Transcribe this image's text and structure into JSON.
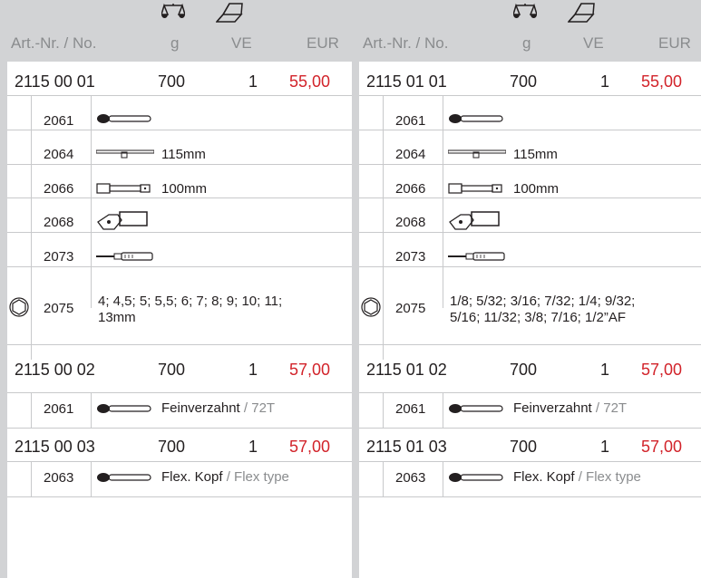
{
  "header": {
    "col1": "Art.-Nr. / No.",
    "col2": "g",
    "col3": "VE",
    "col4": "EUR",
    "icons": [
      "weight-scale-icon",
      "box-icon"
    ]
  },
  "left": {
    "products": [
      {
        "art": "2115 00 01",
        "g": "700",
        "ve": "1",
        "eur": "55,00"
      },
      {
        "art": "2115 00 02",
        "g": "700",
        "ve": "1",
        "eur": "57,00"
      },
      {
        "art": "2115 00 03",
        "g": "700",
        "ve": "1",
        "eur": "57,00"
      }
    ],
    "items": [
      {
        "no": "2061",
        "text": ""
      },
      {
        "no": "2064",
        "text": "115mm"
      },
      {
        "no": "2066",
        "text": "100mm"
      },
      {
        "no": "2068",
        "text": ""
      },
      {
        "no": "2073",
        "text": ""
      },
      {
        "no": "2075",
        "text_l1": "4; 4,5; 5; 5,5; 6; 7; 8; 9; 10; 11;",
        "text_l2": "13mm"
      }
    ],
    "item_2": {
      "no": "2061",
      "text": "Feinverzahnt",
      "text_gray": "/ 72T"
    },
    "item_3": {
      "no": "2063",
      "text": "Flex. Kopf",
      "text_gray": "/ Flex type"
    }
  },
  "right": {
    "products": [
      {
        "art": "2115 01 01",
        "g": "700",
        "ve": "1",
        "eur": "55,00"
      },
      {
        "art": "2115 01 02",
        "g": "700",
        "ve": "1",
        "eur": "57,00"
      },
      {
        "art": "2115 01 03",
        "g": "700",
        "ve": "1",
        "eur": "57,00"
      }
    ],
    "items": [
      {
        "no": "2061",
        "text": ""
      },
      {
        "no": "2064",
        "text": "115mm"
      },
      {
        "no": "2066",
        "text": "100mm"
      },
      {
        "no": "2068",
        "text": ""
      },
      {
        "no": "2073",
        "text": ""
      },
      {
        "no": "2075",
        "text_l1": "1/8; 5/32; 3/16; 7/32; 1/4; 9/32;",
        "text_l2": "5/16; 11/32; 3/8; 7/16; 1/2”AF"
      }
    ],
    "item_2": {
      "no": "2061",
      "text": "Feinverzahnt",
      "text_gray": "/ 72T"
    },
    "item_3": {
      "no": "2063",
      "text": "Flex. Kopf",
      "text_gray": "/ Flex type"
    }
  },
  "colors": {
    "price": "#d2232a",
    "muted": "#8a8c8e",
    "bg": "#d2d3d5"
  }
}
